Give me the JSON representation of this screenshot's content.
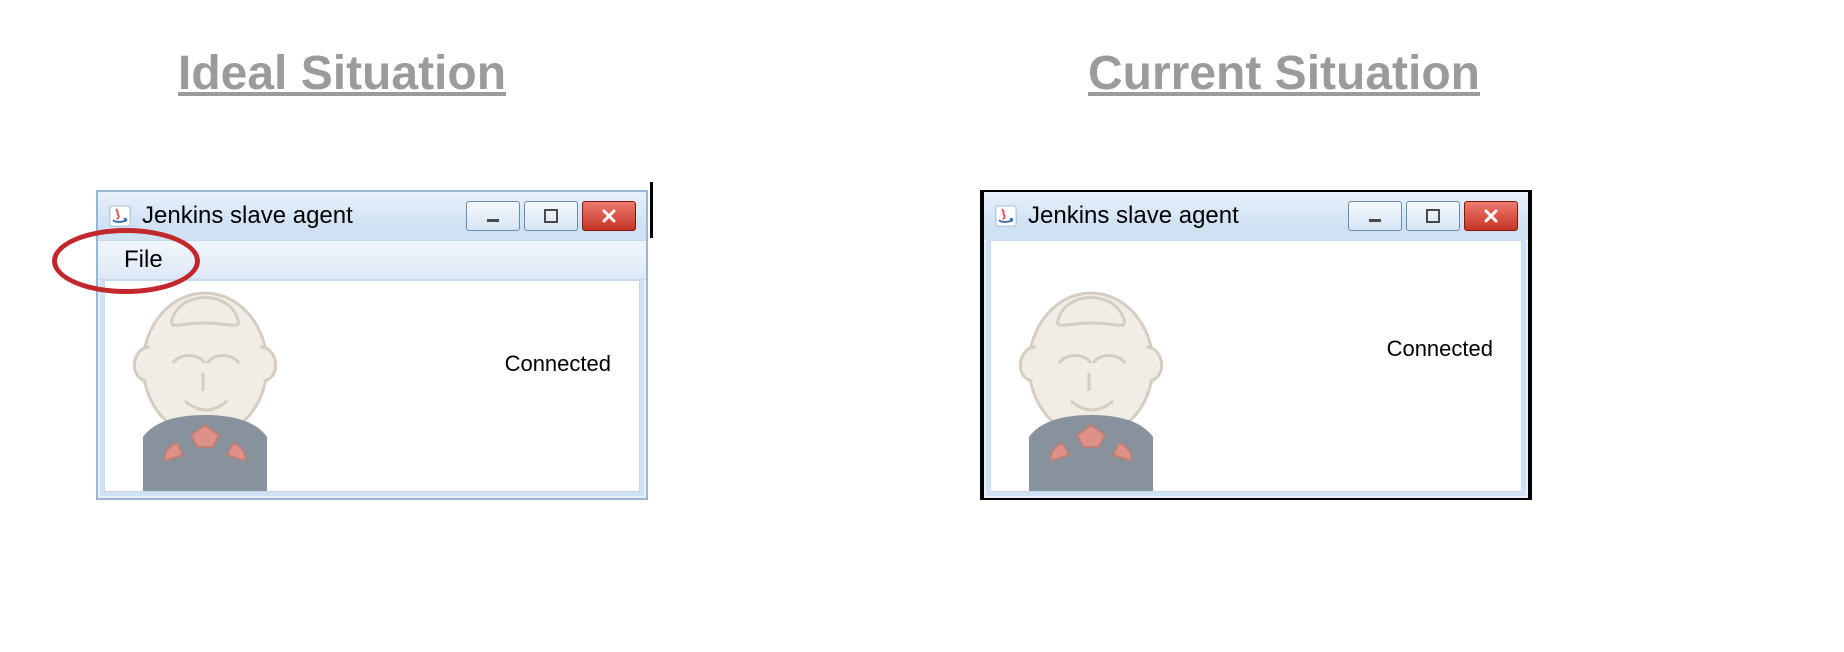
{
  "headings": {
    "left": "Ideal Situation",
    "right": "Current Situation"
  },
  "window": {
    "title": "Jenkins slave agent",
    "menu_file": "File",
    "status": "Connected",
    "icons": {
      "app": "java-icon",
      "minimize": "minimize-icon",
      "maximize": "maximize-icon",
      "close": "close-icon"
    },
    "colors": {
      "frame": "#cfe1f3",
      "close": "#c43424",
      "annotation": "#c1272d",
      "heading": "#9b9b9b"
    }
  }
}
